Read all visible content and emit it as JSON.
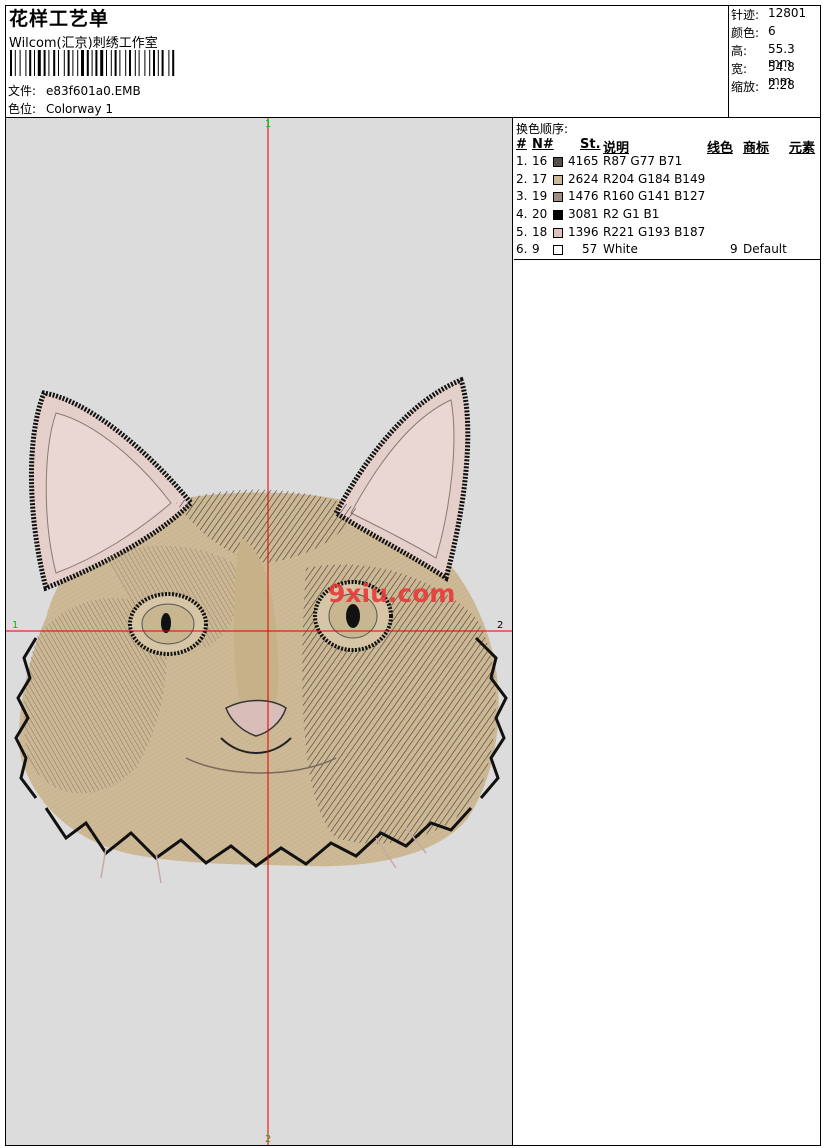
{
  "header": {
    "title": "花样工艺单",
    "studio": "Wilcom(汇京)刺绣工作室",
    "file_label": "文件:",
    "file_value": "e83f601a0.EMB",
    "colorway_label": "色位:",
    "colorway_value": "Colorway 1"
  },
  "stats": [
    {
      "label": "针迹:",
      "value": "12801"
    },
    {
      "label": "颜色:",
      "value": "6"
    },
    {
      "label": "高:",
      "value": "55.3 mm"
    },
    {
      "label": "宽:",
      "value": "54.8 mm"
    },
    {
      "label": "缩放:",
      "value": "2.28"
    }
  ],
  "canvas": {
    "marker_top": "1",
    "marker_bottom": "2",
    "marker_left": "1",
    "marker_right": "2",
    "watermark": "9xiu.com",
    "marker_color": "#00c000",
    "crosshair_color": "#e00000",
    "background_color": "#dcdcdc"
  },
  "sequence": {
    "title": "换色顺序:",
    "headers": {
      "index": "#",
      "needle": "N#",
      "stitches": "St.",
      "desc": "说明",
      "thread": "线色",
      "brand": "商标",
      "element": "元素"
    },
    "rows": [
      {
        "index": "1.",
        "needle": "16",
        "stitches": "4165",
        "desc": "R87 G77 B71",
        "color": "#574d47",
        "thread": "",
        "brand": ""
      },
      {
        "index": "2.",
        "needle": "17",
        "stitches": "2624",
        "desc": "R204 G184 B149",
        "color": "#ccb895",
        "thread": "",
        "brand": ""
      },
      {
        "index": "3.",
        "needle": "19",
        "stitches": "1476",
        "desc": "R160 G141 B127",
        "color": "#a08d7f",
        "thread": "",
        "brand": ""
      },
      {
        "index": "4.",
        "needle": "20",
        "stitches": "3081",
        "desc": "R2 G1 B1",
        "color": "#020101",
        "thread": "",
        "brand": ""
      },
      {
        "index": "5.",
        "needle": "18",
        "stitches": "1396",
        "desc": "R221 G193 B187",
        "color": "#ddc1bb",
        "thread": "",
        "brand": ""
      },
      {
        "index": "6.",
        "needle": "9",
        "stitches": "57",
        "desc": "White",
        "color": "#ffffff",
        "thread": "9",
        "brand": "Default"
      }
    ]
  }
}
